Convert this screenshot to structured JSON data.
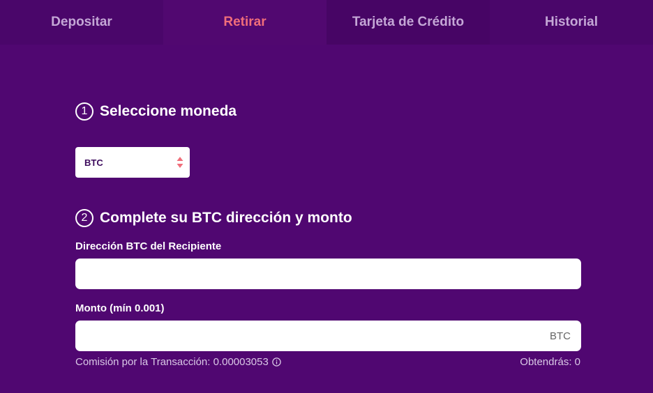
{
  "tabs": [
    {
      "label": "Depositar",
      "active": false
    },
    {
      "label": "Retirar",
      "active": true
    },
    {
      "label": "Tarjeta de Crédito",
      "active": false
    },
    {
      "label": "Historial",
      "active": false
    }
  ],
  "step1": {
    "number": "1",
    "title": "Seleccione moneda"
  },
  "currency_select": {
    "value": "BTC",
    "icon": "sort-arrows-icon"
  },
  "step2": {
    "number": "2",
    "title": "Complete su BTC dirección y monto"
  },
  "address": {
    "label": "Dirección BTC del Recipiente",
    "value": "",
    "placeholder": ""
  },
  "amount": {
    "label": "Monto  (mín 0.001)",
    "value": "",
    "placeholder": "",
    "unit": "BTC"
  },
  "fee": {
    "text": "Comisión por la Transacción: 0.00003053",
    "icon": "info-icon"
  },
  "receive": {
    "text": "Obtendrás: 0"
  },
  "colors": {
    "background": "#500771",
    "accent": "#f06e7a",
    "tab_inactive": "#c4a7d6"
  }
}
